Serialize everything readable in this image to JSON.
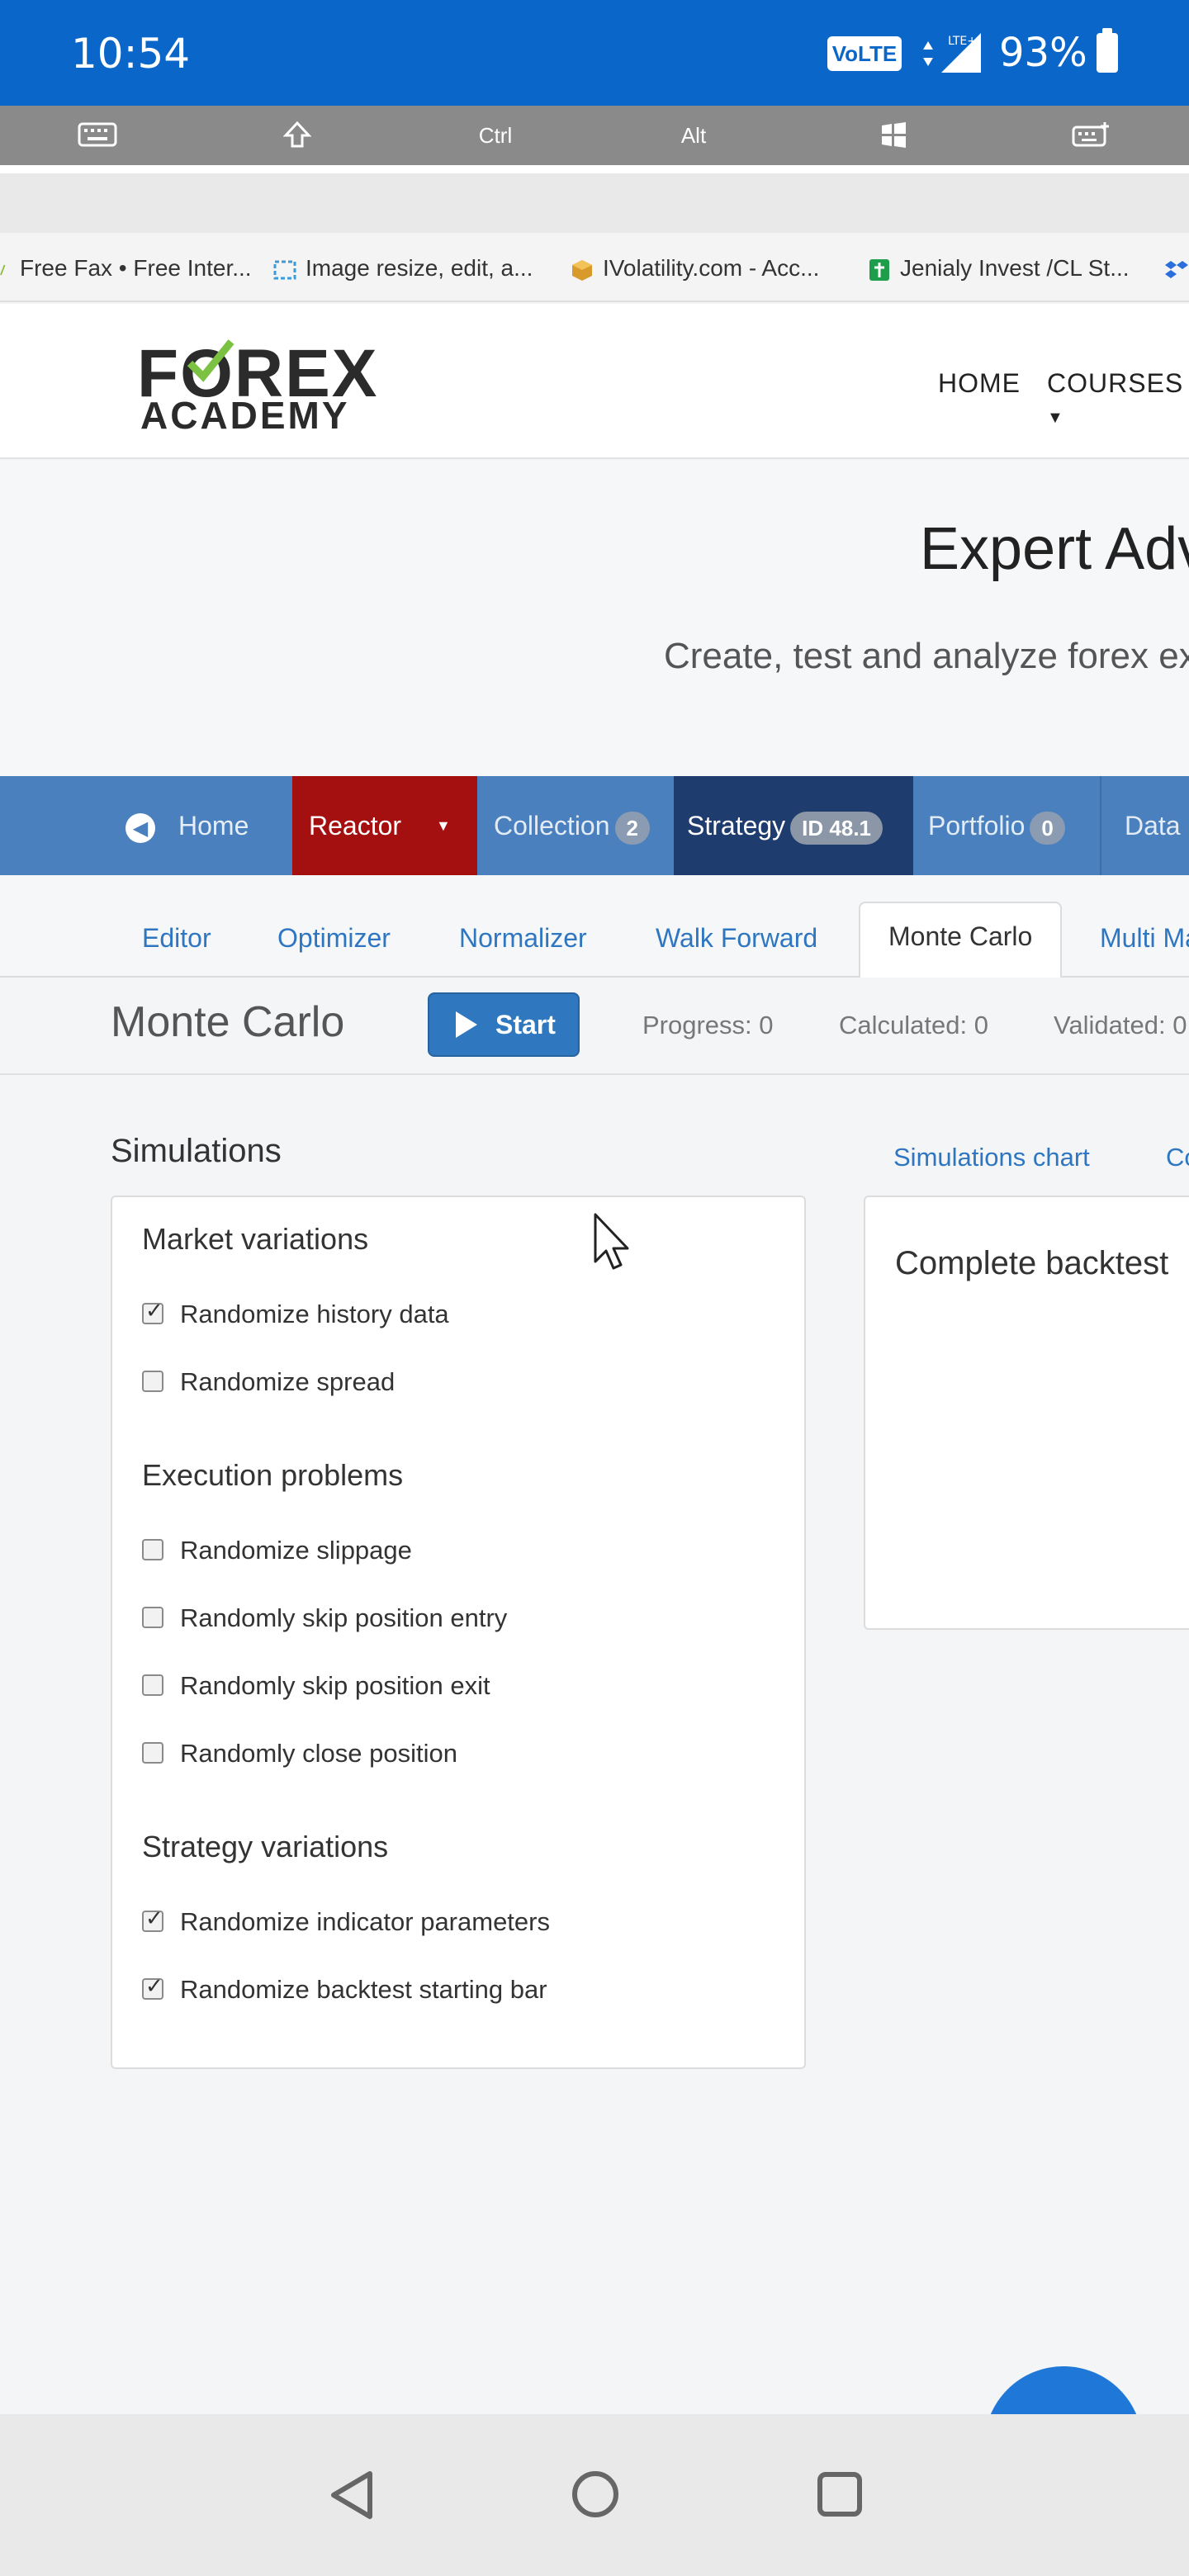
{
  "status_bar": {
    "time": "10:54",
    "volte_label": "VoLTE",
    "network": "LTE+",
    "battery_percent": "93%"
  },
  "keybar": {
    "ctrl": "Ctrl",
    "alt": "Alt"
  },
  "bookmarks": [
    "Free Fax • Free Inter...",
    "Image resize, edit, a...",
    "IVolatility.com - Acc...",
    "Jenialy Invest /CL St..."
  ],
  "header": {
    "logo_line1": "FOREX",
    "logo_line2": "ACADEMY",
    "nav_home": "HOME",
    "nav_courses": "COURSES"
  },
  "hero": {
    "title": "Expert Adv",
    "subtitle": "Create, test and analyze forex ex"
  },
  "appnav": {
    "home": "Home",
    "reactor": "Reactor",
    "collection": "Collection",
    "collection_count": "2",
    "strategy": "Strategy",
    "strategy_id": "ID 48.1",
    "portfolio": "Portfolio",
    "portfolio_count": "0",
    "data": "Data"
  },
  "subtabs": {
    "editor": "Editor",
    "optimizer": "Optimizer",
    "normalizer": "Normalizer",
    "walk_forward": "Walk Forward",
    "monte_carlo": "Monte Carlo",
    "multi_market": "Multi Ma"
  },
  "toolbar": {
    "title": "Monte Carlo",
    "start": "Start",
    "progress": "Progress: 0",
    "calculated": "Calculated: 0",
    "validated": "Validated: 0"
  },
  "simulations": {
    "title": "Simulations",
    "market_variations": "Market variations",
    "randomize_history_data": "Randomize history data",
    "randomize_spread": "Randomize spread",
    "execution_problems": "Execution problems",
    "randomize_slippage": "Randomize slippage",
    "skip_entry": "Randomly skip position entry",
    "skip_exit": "Randomly skip position exit",
    "close_position": "Randomly close position",
    "strategy_variations": "Strategy variations",
    "randomize_indicator_params": "Randomize indicator parameters",
    "randomize_backtest_start": "Randomize backtest starting bar"
  },
  "right": {
    "simulations_chart": "Simulations chart",
    "second_tab": "Co",
    "chart_title": "Complete backtest"
  },
  "colors": {
    "status_bar": "#0a66c8",
    "appnav": "#4a80bd",
    "reactor": "#a40f0f",
    "strategy": "#1e3c6e",
    "accent": "#2f78bf"
  }
}
